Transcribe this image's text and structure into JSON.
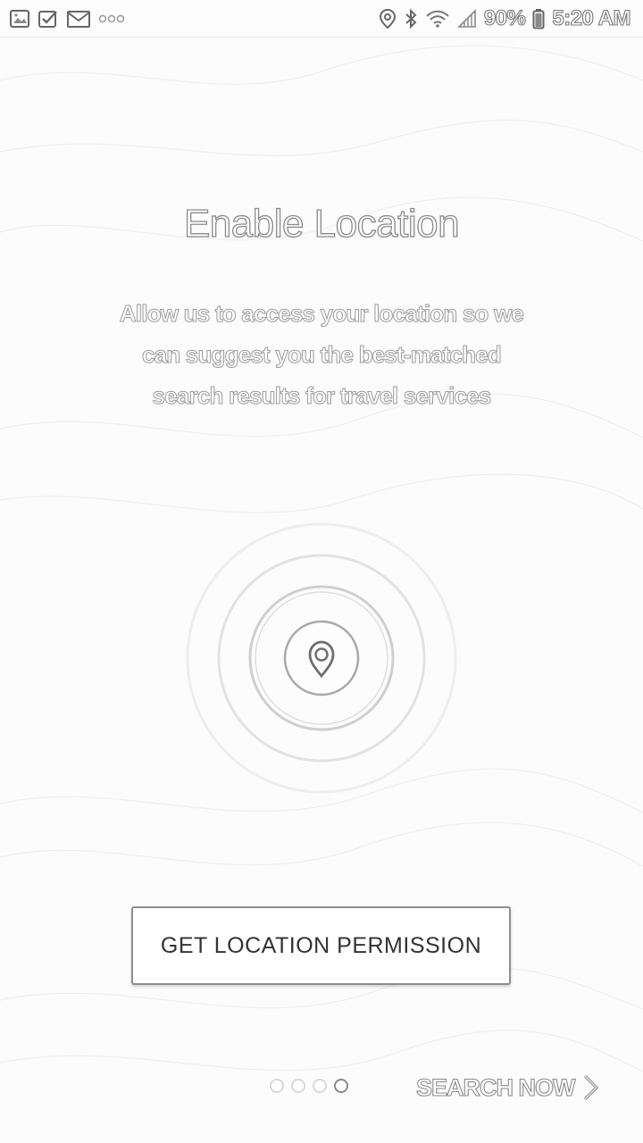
{
  "status_bar": {
    "left_icons": [
      "gallery-icon",
      "check-icon",
      "gmail-icon",
      "more-dots-icon"
    ],
    "right_icons": [
      "location-icon",
      "bluetooth-icon",
      "wifi-icon",
      "signal-icon",
      "battery-icon"
    ],
    "battery_text": "90%",
    "time": "5:20 AM"
  },
  "main": {
    "title": "Enable Location",
    "description_lines": [
      "Allow us to access your location so we",
      "can suggest you the best-matched",
      "search results for travel services"
    ],
    "illustration_icon": "location-pin-icon"
  },
  "actions": {
    "permission_button_label": "GET LOCATION PERMISSION",
    "search_now_label": "SEARCH NOW",
    "search_now_icon": "chevron-right-icon"
  },
  "pager": {
    "total": 4,
    "current": 4
  },
  "colors": {
    "background": "#fcfcfc",
    "outline_text": "#8a8a8a",
    "button_border": "#8d8d8d",
    "button_text": "#333333"
  }
}
